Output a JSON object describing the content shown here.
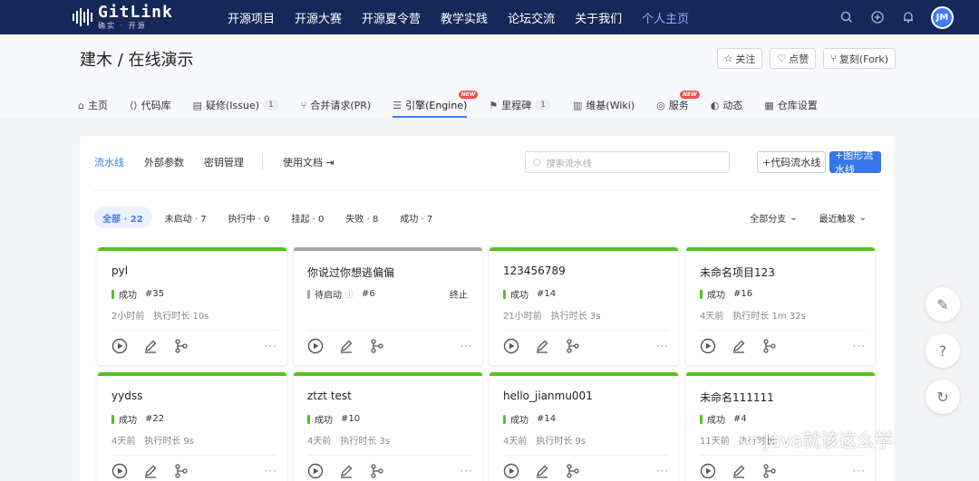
{
  "header": {
    "logo_text": "GitLink",
    "logo_sub": "确实 · 开源",
    "nav": [
      "开源项目",
      "开源大赛",
      "开源夏令营",
      "教学实践",
      "论坛交流",
      "关于我们",
      "个人主页"
    ],
    "avatar": "JM",
    "colors": {
      "bg": "#16275a",
      "active": "#8fb1ff"
    }
  },
  "repo": {
    "title": "建木 / 在线演示",
    "actions": {
      "watch": "关注",
      "star": "点赞",
      "fork": "复刻(Fork)"
    },
    "tabs": [
      {
        "label": "主页",
        "icon": "home-icon"
      },
      {
        "label": "代码库",
        "icon": "code-icon"
      },
      {
        "label": "疑修(Issue)",
        "icon": "issue-icon",
        "count": "1"
      },
      {
        "label": "合并请求(PR)",
        "icon": "pr-icon"
      },
      {
        "label": "引擎(Engine)",
        "icon": "engine-icon",
        "badge": "NEW"
      },
      {
        "label": "里程碑",
        "icon": "milestone-icon",
        "count": "1"
      },
      {
        "label": "维基(Wiki)",
        "icon": "wiki-icon"
      },
      {
        "label": "服务",
        "icon": "service-icon",
        "badge": "NEW"
      },
      {
        "label": "动态",
        "icon": "activity-icon"
      },
      {
        "label": "仓库设置",
        "icon": "settings-icon"
      }
    ]
  },
  "engine": {
    "subnav": [
      "流水线",
      "外部参数",
      "密钥管理"
    ],
    "docs": "使用文档",
    "search_placeholder": "搜索流水线",
    "btn_code": "+代码流水线",
    "btn_graph": "+图形流水线",
    "filters": [
      "全部 · 22",
      "未启动 · 7",
      "执行中 · 0",
      "挂起 · 0",
      "失败 · 8",
      "成功 · 7"
    ],
    "sort_branch": "全部分支",
    "sort_trigger": "最近触发"
  },
  "cards": [
    {
      "name": "pyl",
      "status": "成功",
      "num": "#35",
      "ago": "2小时前",
      "dur": "执行时长 10s",
      "color": "#52c41a",
      "status_color": "#52c41a"
    },
    {
      "name": "你说过你想逃偏偏",
      "status": "待启动",
      "num": "#6",
      "ago": "",
      "dur": "",
      "stop": "终止",
      "color": "#a6a6a6",
      "status_color": "#a6a6a6"
    },
    {
      "name": "123456789",
      "status": "成功",
      "num": "#14",
      "ago": "21小时前",
      "dur": "执行时长 3s",
      "color": "#52c41a",
      "status_color": "#52c41a"
    },
    {
      "name": "未命名项目123",
      "status": "成功",
      "num": "#16",
      "ago": "4天前",
      "dur": "执行时长 1m 32s",
      "color": "#52c41a",
      "status_color": "#52c41a"
    },
    {
      "name": "yydss",
      "status": "成功",
      "num": "#22",
      "ago": "4天前",
      "dur": "执行时长 9s",
      "color": "#52c41a",
      "status_color": "#52c41a"
    },
    {
      "name": "ztzt test",
      "status": "成功",
      "num": "#10",
      "ago": "4天前",
      "dur": "执行时长 3s",
      "color": "#52c41a",
      "status_color": "#52c41a"
    },
    {
      "name": "hello_jianmu001",
      "status": "成功",
      "num": "#14",
      "ago": "4天前",
      "dur": "执行时长 9s",
      "color": "#52c41a",
      "status_color": "#52c41a"
    },
    {
      "name": "未命名111111",
      "status": "成功",
      "num": "#4",
      "ago": "11天前",
      "dur": "执行时长",
      "color": "#52c41a",
      "status_color": "#52c41a"
    }
  ],
  "watermark": "Java就该这么学"
}
